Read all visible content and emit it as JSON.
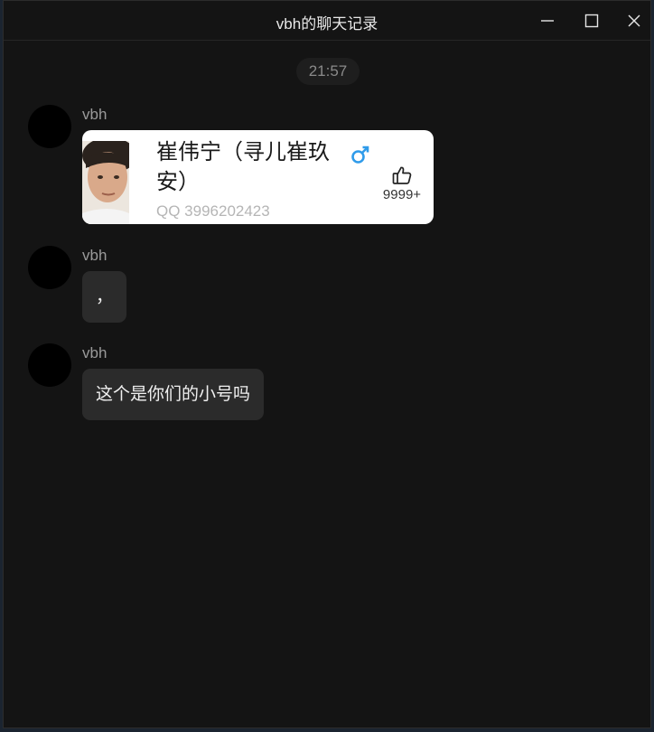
{
  "window": {
    "title": "vbh的聊天记录"
  },
  "timestamp": "21:57",
  "messages": [
    {
      "sender": "vbh",
      "type": "contact-card",
      "card": {
        "name": "崔伟宁（寻儿崔玖安）",
        "gender_icon": "male-icon",
        "qq": "QQ 3996202423",
        "likes": "9999+"
      }
    },
    {
      "sender": "vbh",
      "type": "text",
      "text": "，"
    },
    {
      "sender": "vbh",
      "type": "text",
      "text": "这个是你们的小号吗"
    }
  ],
  "colors": {
    "background": "#141414",
    "bubble": "#2b2b2b",
    "card": "#ffffff",
    "male_accent": "#2f9bea"
  }
}
